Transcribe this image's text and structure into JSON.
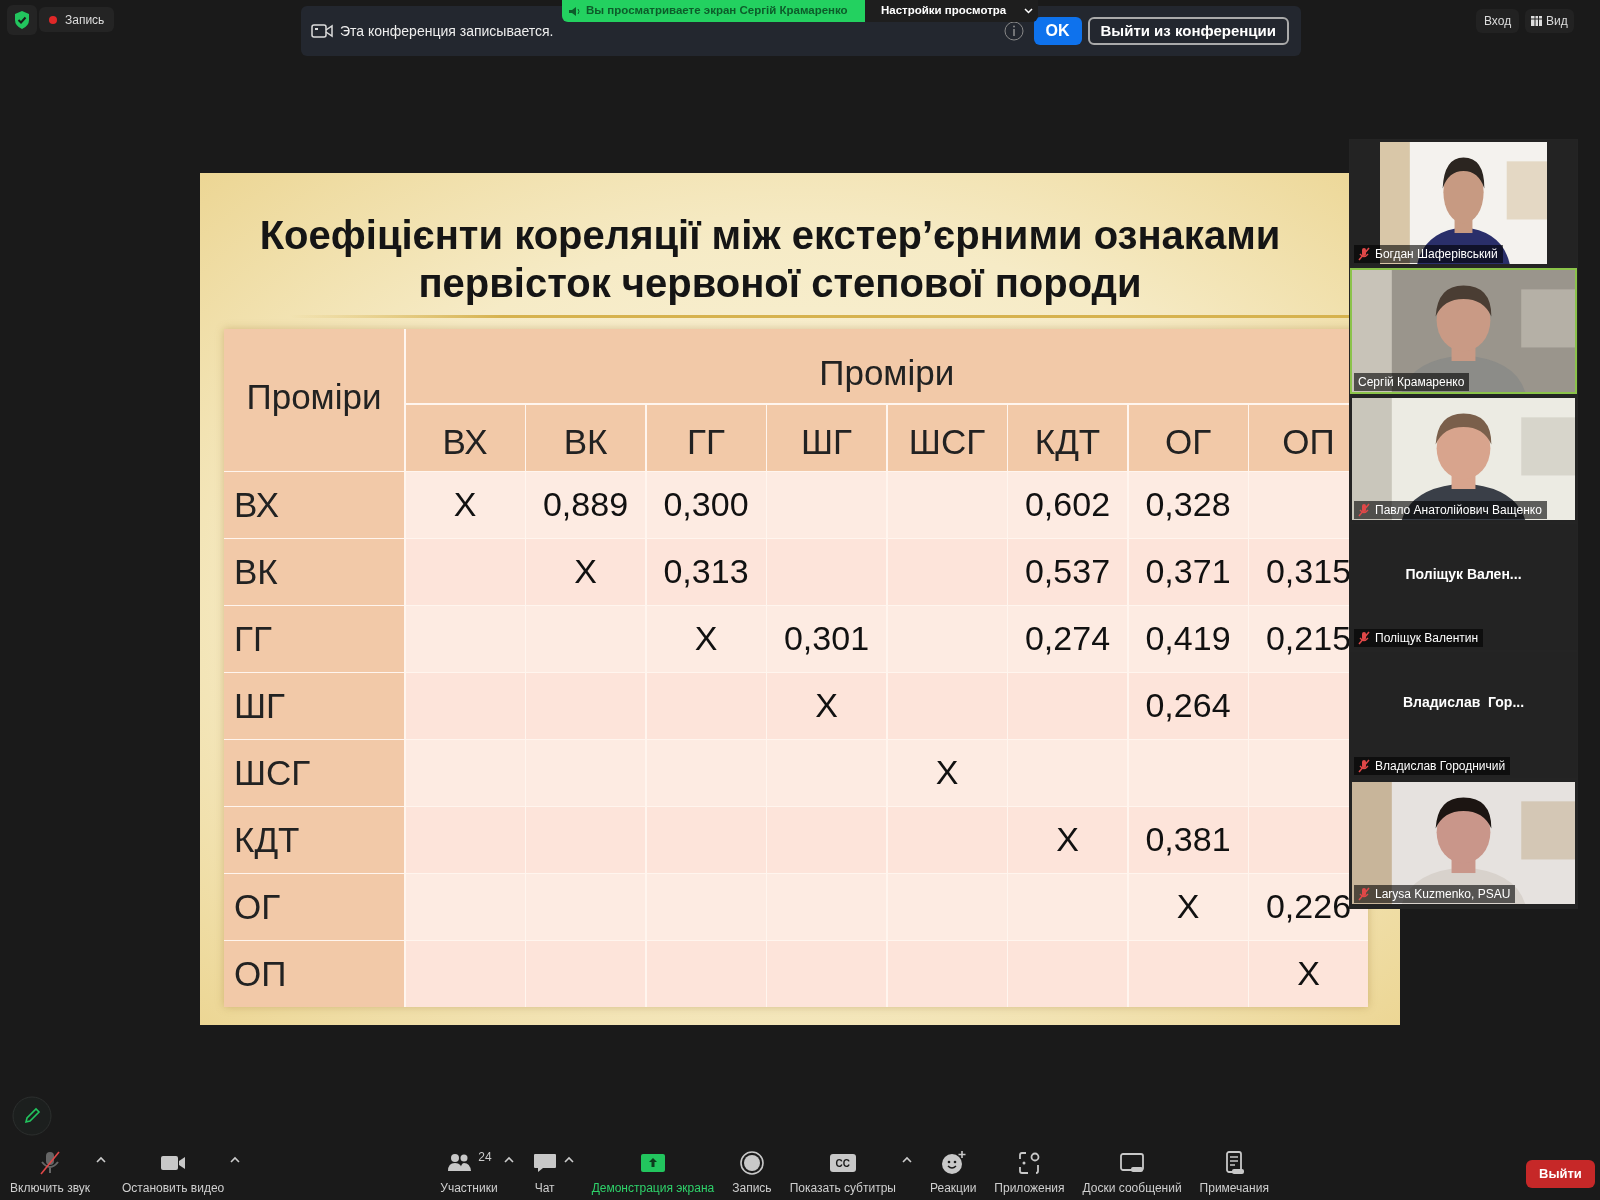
{
  "top_bar": {
    "recording": "Запись",
    "login": "Вход",
    "view": "Вид"
  },
  "share_banner": {
    "text": "Вы просматриваете экран Сергій Крамаренко",
    "settings": "Настройки просмотра"
  },
  "notification": {
    "text": "Эта конференция записывается.",
    "ok": "OK",
    "leave": "Выйти из конференции"
  },
  "slide": {
    "title_lines": [
      "Коефіцієнти кореляції між екстер’єрними ознаками",
      "первісток червоної степової породи"
    ],
    "table": {
      "corner": "Проміри",
      "group_header": "Проміри",
      "columns": [
        "ВХ",
        "ВК",
        "ГГ",
        "ШГ",
        "ШСГ",
        "КДТ",
        "ОГ",
        "ОП"
      ],
      "rows": [
        {
          "label": "ВХ",
          "cells": [
            "X",
            "0,889",
            "0,300",
            null,
            null,
            "0,602",
            "0,328",
            null
          ]
        },
        {
          "label": "ВК",
          "cells": [
            null,
            "X",
            "0,313",
            null,
            null,
            "0,537",
            "0,371",
            "0,315"
          ]
        },
        {
          "label": "ГГ",
          "cells": [
            null,
            null,
            "X",
            "0,301",
            null,
            "0,274",
            "0,419",
            "0,215"
          ]
        },
        {
          "label": "ШГ",
          "cells": [
            null,
            null,
            null,
            "X",
            null,
            null,
            "0,264",
            null
          ]
        },
        {
          "label": "ШСГ",
          "cells": [
            null,
            null,
            null,
            null,
            "X",
            null,
            null,
            null
          ]
        },
        {
          "label": "КДТ",
          "cells": [
            null,
            null,
            null,
            null,
            null,
            "X",
            "0,381",
            null
          ]
        },
        {
          "label": "ОГ",
          "cells": [
            null,
            null,
            null,
            null,
            null,
            null,
            "X",
            "0,226"
          ]
        },
        {
          "label": "ОП",
          "cells": [
            null,
            null,
            null,
            null,
            null,
            null,
            null,
            "X"
          ]
        }
      ]
    }
  },
  "participants": [
    {
      "kind": "video",
      "name": "Богдан Шаферівський",
      "muted": true,
      "speaking": false
    },
    {
      "kind": "video",
      "name": "Сергій Крамаренко",
      "muted": false,
      "speaking": true
    },
    {
      "kind": "video",
      "name": "Павло Анатолійович Ващенко",
      "muted": true,
      "speaking": false
    },
    {
      "kind": "avatar",
      "display_name": "Поліщук Вален...",
      "name": "Поліщук Валентин",
      "muted": true,
      "speaking": false
    },
    {
      "kind": "avatar",
      "display_name": "Владислав  Гор...",
      "name": "Владислав Городничий",
      "muted": true,
      "speaking": false
    },
    {
      "kind": "video",
      "name": "Larysa Kuzmenko, PSAU",
      "muted": true,
      "speaking": false
    }
  ],
  "toolbar": {
    "left": [
      {
        "kind": "mic",
        "label": "Включить звук",
        "muted": true,
        "caret": true
      },
      {
        "kind": "camera",
        "label": "Остановить видео",
        "caret": true
      }
    ],
    "center": [
      {
        "kind": "participants",
        "label": "Участники",
        "count": "24",
        "caret": true
      },
      {
        "kind": "chat",
        "label": "Чат",
        "caret": true
      },
      {
        "kind": "share",
        "label": "Демонстрация экрана",
        "highlighted": true,
        "caret": false
      },
      {
        "kind": "record",
        "label": "Запись",
        "caret": false
      },
      {
        "kind": "captions",
        "label": "Показать субтитры",
        "icon_text": "CC",
        "caret": true
      },
      {
        "kind": "reactions",
        "label": "Реакции",
        "caret": false
      },
      {
        "kind": "apps",
        "label": "Приложения",
        "caret": false
      },
      {
        "kind": "whiteboards",
        "label": "Доски сообщений",
        "caret": false
      },
      {
        "kind": "notes",
        "label": "Примечания",
        "caret": false
      }
    ],
    "leave": "Выйти"
  }
}
